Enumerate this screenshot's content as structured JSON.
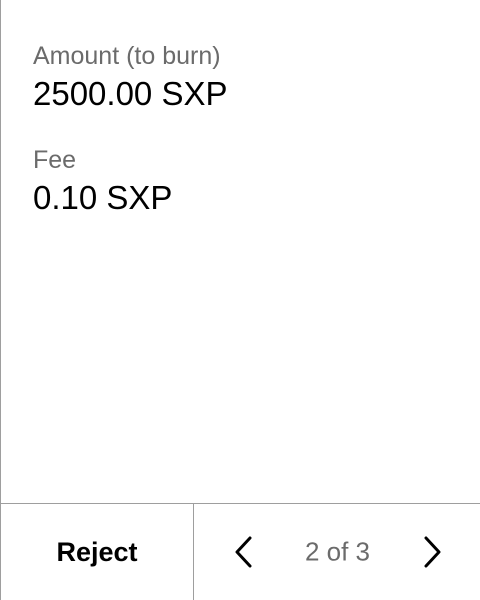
{
  "transaction": {
    "amount_label": "Amount (to burn)",
    "amount_value": "2500.00 SXP",
    "fee_label": "Fee",
    "fee_value": "0.10 SXP"
  },
  "footer": {
    "reject_label": "Reject",
    "page_indicator": "2 of 3",
    "prev_icon": "chevron-left-icon",
    "next_icon": "chevron-right-icon"
  }
}
